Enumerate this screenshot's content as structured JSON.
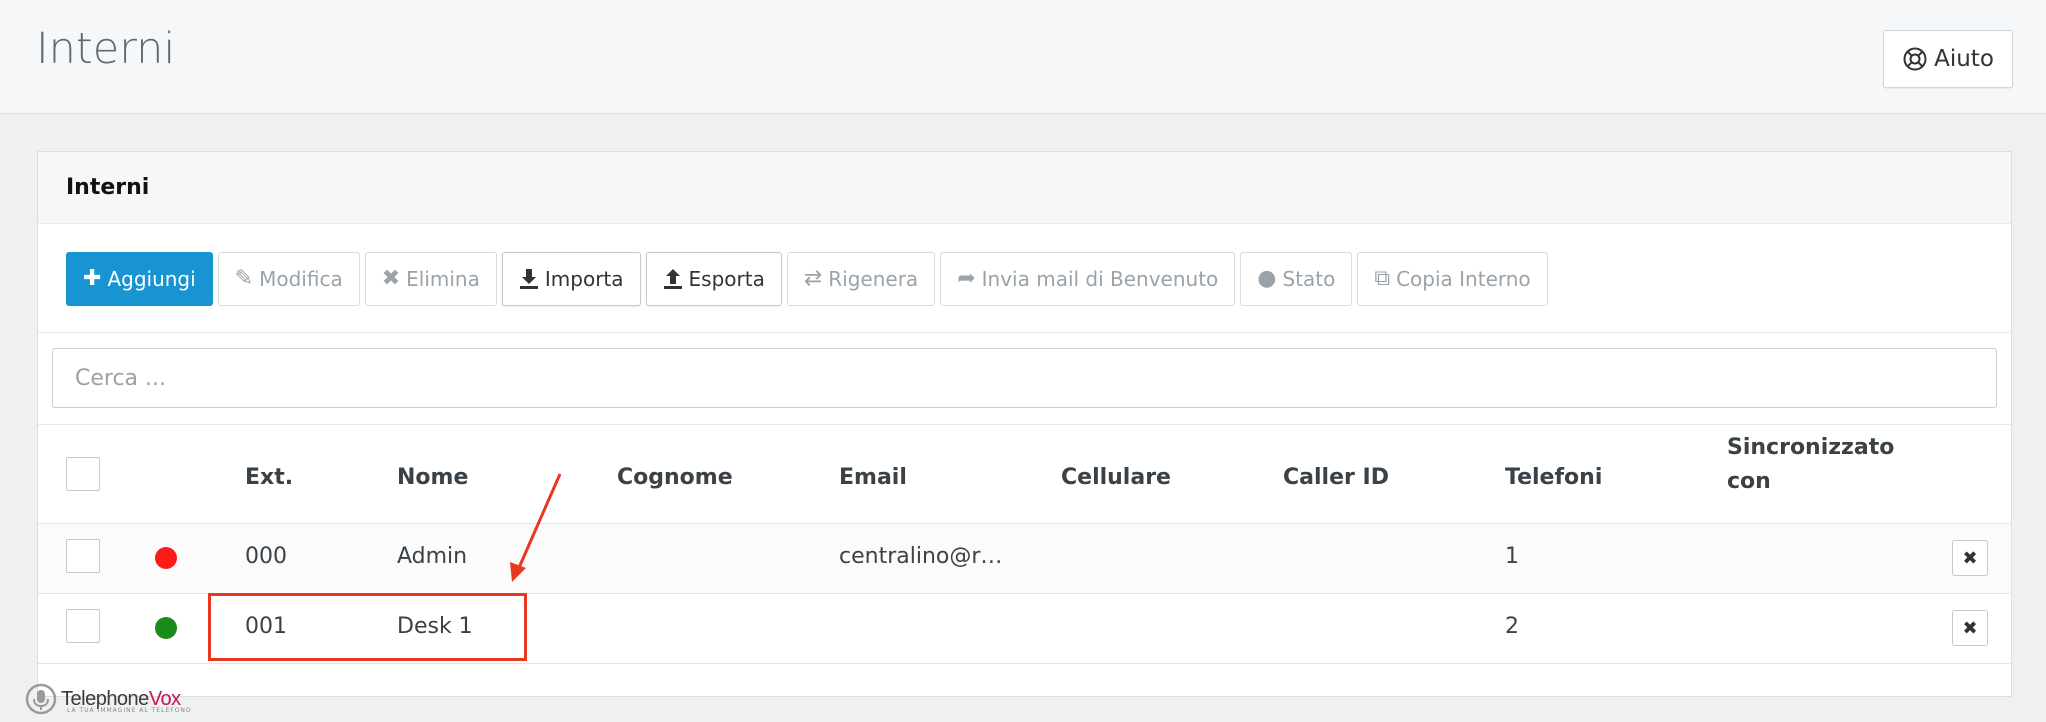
{
  "header": {
    "title": "Interni",
    "help_label": "Aiuto"
  },
  "panel": {
    "title": "Interni",
    "toolbar": [
      {
        "label": "Aggiungi",
        "icon": "plus-icon",
        "state": "primary"
      },
      {
        "label": "Modifica",
        "icon": "pencil-icon",
        "state": "disabled"
      },
      {
        "label": "Elimina",
        "icon": "close-icon",
        "state": "disabled"
      },
      {
        "label": "Importa",
        "icon": "download-icon",
        "state": "enabled"
      },
      {
        "label": "Esporta",
        "icon": "upload-icon",
        "state": "enabled"
      },
      {
        "label": "Rigenera",
        "icon": "retweet-icon",
        "state": "disabled"
      },
      {
        "label": "Invia mail di Benvenuto",
        "icon": "share-icon",
        "state": "disabled"
      },
      {
        "label": "Stato",
        "icon": "circle-icon",
        "state": "disabled"
      },
      {
        "label": "Copia Interno",
        "icon": "copy-icon",
        "state": "disabled"
      }
    ],
    "search": {
      "placeholder": "Cerca ...",
      "value": ""
    }
  },
  "table": {
    "columns": [
      "Ext.",
      "Nome",
      "Cognome",
      "Email",
      "Cellulare",
      "Caller ID",
      "Telefoni",
      "Sincronizzato con"
    ],
    "rows": [
      {
        "status_color": "#ff1a1a",
        "ext": "000",
        "nome": "Admin",
        "cognome": "",
        "email": "centralino@r…",
        "cellulare": "",
        "caller_id": "",
        "telefoni": "1",
        "sincronizzato": ""
      },
      {
        "status_color": "#1a8a1a",
        "ext": "001",
        "nome": "Desk 1",
        "cognome": "",
        "email": "",
        "cellulare": "",
        "caller_id": "",
        "telefoni": "2",
        "sincronizzato": ""
      }
    ]
  },
  "annotation": {
    "color": "#e8381f"
  },
  "logo": {
    "part1": "Telephone",
    "part2": "Vox",
    "tagline": "LA TUA IMMAGINE AL TELEFONO"
  }
}
